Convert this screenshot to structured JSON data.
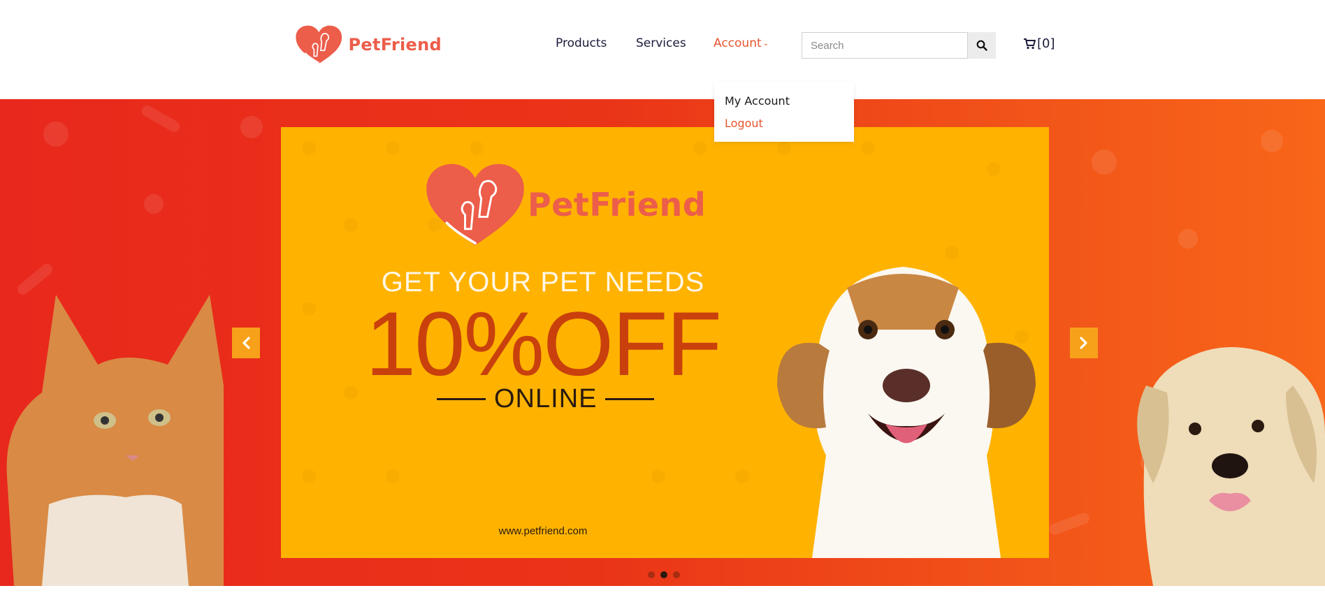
{
  "brand": {
    "name": "PetFriend",
    "accent": "#ec5d4a",
    "nav_accent": "#e8552f"
  },
  "nav": {
    "products": "Products",
    "services": "Services",
    "account": "Account",
    "account_chevron": "⌄"
  },
  "search": {
    "placeholder": "Search",
    "button_icon": "search-icon"
  },
  "cart": {
    "label": "[0]",
    "icon": "cart-icon"
  },
  "account_menu": {
    "items": [
      {
        "label": "My Account"
      },
      {
        "label": "Logout"
      }
    ]
  },
  "hero": {
    "slide": {
      "brand": "PetFriend",
      "headline": "GET YOUR PET NEEDS",
      "offer": "10%OFF",
      "subline": "ONLINE",
      "url": "www.petfriend.com",
      "background": "#ffb300"
    },
    "prev_icon": "chevron-left-icon",
    "next_icon": "chevron-right-icon",
    "dots": {
      "count": 3,
      "active_index": 1
    }
  }
}
